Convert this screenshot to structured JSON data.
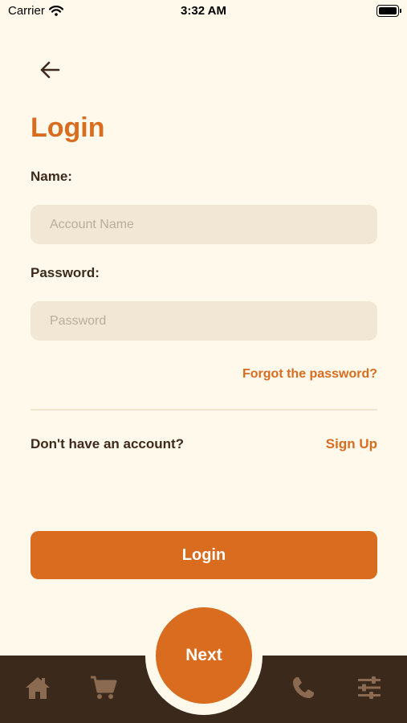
{
  "status_bar": {
    "carrier": "Carrier",
    "time": "3:32 AM"
  },
  "header": {
    "back_icon": "arrow-left-icon",
    "title": "Login"
  },
  "form": {
    "name_label": "Name:",
    "name_placeholder": "Account Name",
    "name_value": "",
    "password_label": "Password:",
    "password_placeholder": "Password",
    "password_value": "",
    "forgot_link": "Forgot the password?"
  },
  "signup": {
    "prompt": "Don't have an account?",
    "link": "Sign Up"
  },
  "login_button": "Login",
  "tab_bar": {
    "items": [
      {
        "icon": "home-icon"
      },
      {
        "icon": "cart-icon"
      },
      {
        "icon": "phone-icon"
      },
      {
        "icon": "sliders-icon"
      }
    ],
    "center_button": "Next"
  },
  "colors": {
    "background": "#FEF9EB",
    "accent": "#D96C1F",
    "text": "#3E2A1C",
    "input_bg": "#F1E7D4",
    "tab_bar": "#3B291B",
    "tab_icon": "#8B6A52"
  }
}
